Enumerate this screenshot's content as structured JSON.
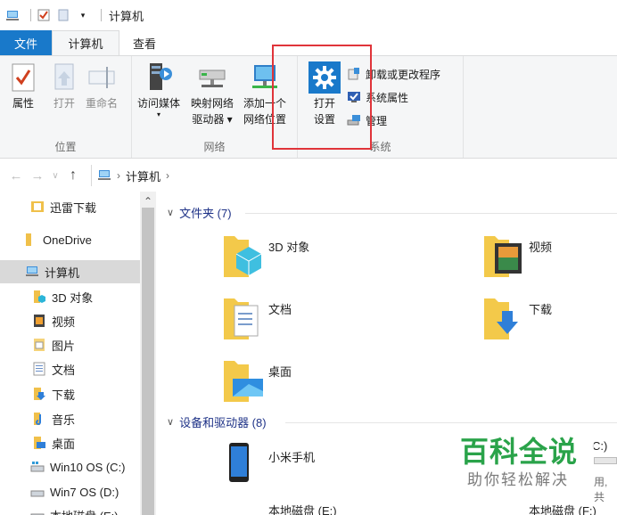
{
  "titlebar": {
    "title": "计算机"
  },
  "tabs": {
    "file": "文件",
    "computer": "计算机",
    "view": "查看"
  },
  "ribbon": {
    "location": {
      "label": "位置",
      "properties": "属性",
      "open": "打开",
      "rename": "重命名"
    },
    "network": {
      "label": "网络",
      "media_line1": "访问媒体",
      "map_line1": "映射网络",
      "map_line2": "驱动器",
      "add_line1": "添加一个",
      "add_line2": "网络位置"
    },
    "system": {
      "label": "系统",
      "open_settings_line1": "打开",
      "open_settings_line2": "设置",
      "uninstall": "卸载或更改程序",
      "system_properties": "系统属性",
      "manage": "管理"
    }
  },
  "address": {
    "path": "计算机"
  },
  "nav": {
    "items": [
      {
        "label": "迅雷下载"
      },
      {
        "label": "OneDrive"
      },
      {
        "label": "计算机"
      },
      {
        "label": "3D 对象"
      },
      {
        "label": "视频"
      },
      {
        "label": "图片"
      },
      {
        "label": "文档"
      },
      {
        "label": "下载"
      },
      {
        "label": "音乐"
      },
      {
        "label": "桌面"
      },
      {
        "label": "Win10 OS (C:)"
      },
      {
        "label": "Win7 OS (D:)"
      },
      {
        "label": "本地磁盘 (E:)"
      }
    ]
  },
  "content": {
    "folders_header": "文件夹 (7)",
    "folders": [
      {
        "label": "3D 对象"
      },
      {
        "label": "视频"
      },
      {
        "label": "文档"
      },
      {
        "label": "下载"
      },
      {
        "label": "桌面"
      }
    ],
    "devices_header": "设备和驱动器 (8)",
    "devices": [
      {
        "label": "小米手机"
      },
      {
        "label": "本地磁盘 (E:)"
      },
      {
        "label": "本地磁盘 (F:)"
      },
      {
        "label": "C:)"
      },
      {
        "label": "用, 共"
      }
    ]
  },
  "watermark": {
    "title": "百科全说",
    "subtitle": "助你轻松解决"
  },
  "colors": {
    "file_tab": "#1979ca",
    "highlight": "#e0343a",
    "section": "#1e3287",
    "watermark": "#2aa34a"
  }
}
